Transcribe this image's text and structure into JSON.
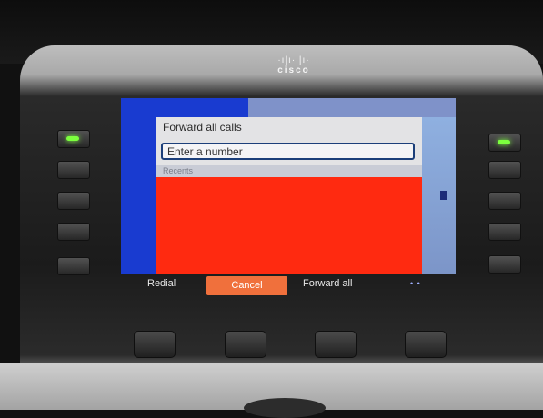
{
  "brand": {
    "logo_bars": "·ı|ı·ı|ı·",
    "logo_text": "cisco"
  },
  "dialog": {
    "title": "Forward all calls",
    "input_placeholder": "Enter a number",
    "recents_label": "Recents"
  },
  "softkeys": {
    "redial": "Redial",
    "cancel": "Cancel",
    "forward_all": "Forward all",
    "page_indicator": "• •"
  },
  "line_keys": {
    "left_lit": [
      true,
      false,
      false,
      false,
      false
    ],
    "right_lit": [
      true,
      false,
      false,
      false,
      false
    ]
  },
  "colors": {
    "led_green": "#7cff3e",
    "cancel_orange": "#f0703c",
    "recents_red": "#ff2a10",
    "screen_blue": "#1a39c9"
  }
}
